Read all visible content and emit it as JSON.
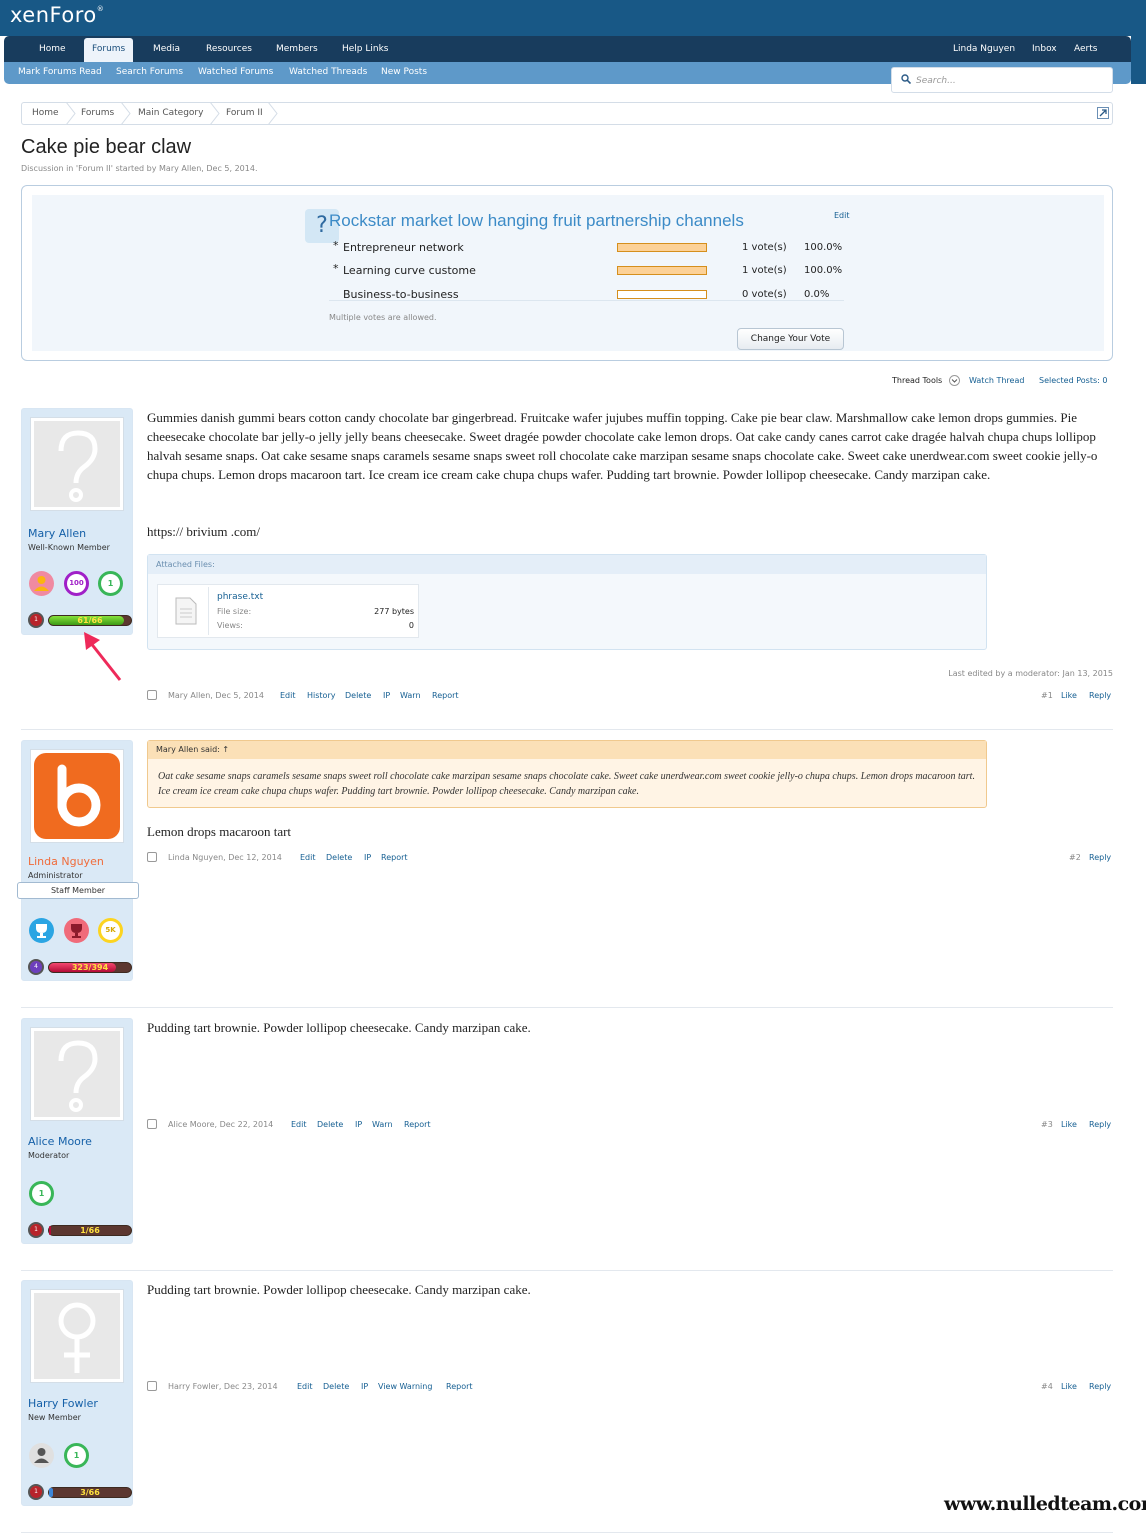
{
  "app": {
    "logo_text": "xenForo",
    "logo_sup": "®"
  },
  "nav": {
    "tabs": [
      {
        "label": "Home",
        "selected": false
      },
      {
        "label": "Forums",
        "selected": true
      },
      {
        "label": "Media",
        "selected": false
      },
      {
        "label": "Resources",
        "selected": false
      },
      {
        "label": "Members",
        "selected": false
      },
      {
        "label": "Help Links",
        "selected": false
      }
    ],
    "user_links": [
      "Linda Nguyen",
      "Inbox",
      "Aerts"
    ],
    "subtabs": [
      "Mark Forums Read",
      "Search Forums",
      "Watched Forums",
      "Watched Threads",
      "New Posts"
    ],
    "search_placeholder": "Search..."
  },
  "breadcrumb": [
    "Home",
    "Forums",
    "Main Category",
    "Forum II"
  ],
  "thread": {
    "title": "Cake pie bear claw",
    "description": "Discussion in 'Forum II' started by Mary Allen, Dec 5, 2014."
  },
  "poll": {
    "question": "Rockstar market low hanging fruit partnership channels",
    "edit_label": "Edit",
    "options": [
      {
        "bullet": "*",
        "text": "Entrepreneur network",
        "votes": "1 vote(s)",
        "percent": "100.0%",
        "fraction": 1.0
      },
      {
        "bullet": "*",
        "text": "Learning curve custome",
        "votes": "1 vote(s)",
        "percent": "100.0%",
        "fraction": 1.0
      },
      {
        "bullet": "",
        "text": "Business-to-business",
        "votes": "0 vote(s)",
        "percent": "0.0%",
        "fraction": 0.0
      }
    ],
    "footer": "Multiple votes are allowed.",
    "change_button": "Change Your Vote"
  },
  "thread_tools": {
    "tools": "Thread Tools",
    "watch": "Watch Thread",
    "selected": "Selected Posts: 0"
  },
  "posts": [
    {
      "author": "Mary Allen",
      "title": "Well-Known Member",
      "author_color": "#1560a8",
      "trophies": [
        "person",
        "100",
        "1"
      ],
      "level": "1",
      "xp": "61/66",
      "xp_fraction": 0.92,
      "body": "Gummies danish gummi bears cotton candy chocolate bar gingerbread. Fruitcake wafer jujubes muffin topping. Cake pie bear claw. Marshmallow cake lemon drops gummies. Pie cheesecake chocolate bar jelly-o jelly jelly beans cheesecake. Sweet dragée powder chocolate cake lemon drops. Oat cake candy canes carrot cake dragée halvah chupa chups lollipop halvah sesame snaps. Oat cake sesame snaps caramels sesame snaps sweet roll chocolate cake marzipan sesame snaps chocolate cake. Sweet cake unerdwear.com sweet cookie jelly-o chupa chups. Lemon drops macaroon tart. Ice cream ice cream cake chupa chups wafer. Pudding tart brownie. Powder lollipop cheesecake. Candy marzipan cake.",
      "link": "https:// brivium .com/",
      "attachment": {
        "header": "Attached Files:",
        "name": "phrase.txt",
        "size_label": "File size:",
        "size": "277 bytes",
        "views_label": "Views:",
        "views": "0"
      },
      "edited": "Last edited by a moderator: Jan 13, 2015",
      "meta": "Mary Allen, Dec 5, 2014",
      "links": [
        "Edit",
        "History",
        "Delete",
        "IP",
        "Warn",
        "Report"
      ],
      "num": "#1",
      "actions": [
        "Like",
        "Reply"
      ]
    },
    {
      "author": "Linda Nguyen",
      "title": "Administrator",
      "staff": "Staff Member",
      "author_color": "#f06b3a",
      "trophies": [
        "trophy",
        "trophy",
        "5K"
      ],
      "level": "4",
      "xp": "323/394",
      "xp_fraction": 0.82,
      "quote_header": "Mary Allen said: ↑",
      "quote": "Oat cake sesame snaps caramels sesame snaps sweet roll chocolate cake marzipan sesame snaps chocolate cake. Sweet cake unerdwear.com sweet cookie jelly-o chupa chups. Lemon drops macaroon tart. Ice cream ice cream cake chupa chups wafer. Pudding tart brownie. Powder lollipop cheesecake. Candy marzipan cake.",
      "body": "Lemon drops macaroon tart",
      "meta": "Linda Nguyen, Dec 12, 2014",
      "links": [
        "Edit",
        "Delete",
        "IP",
        "Report"
      ],
      "num": "#2",
      "actions": [
        "Reply"
      ]
    },
    {
      "author": "Alice Moore",
      "title": "Moderator",
      "author_color": "#1560a8",
      "trophies": [
        "1"
      ],
      "level": "1",
      "xp": "1/66",
      "xp_fraction": 0.02,
      "body": "Pudding tart brownie. Powder lollipop cheesecake. Candy marzipan cake.",
      "meta": "Alice Moore, Dec 22, 2014",
      "links": [
        "Edit",
        "Delete",
        "IP",
        "Warn",
        "Report"
      ],
      "num": "#3",
      "actions": [
        "Like",
        "Reply"
      ]
    },
    {
      "author": "Harry Fowler",
      "title": "New Member",
      "author_color": "#1560a8",
      "trophies": [
        "person",
        "1"
      ],
      "level": "1",
      "xp": "3/66",
      "xp_fraction": 0.05,
      "body": "Pudding tart brownie. Powder lollipop cheesecake. Candy marzipan cake.",
      "meta": "Harry Fowler, Dec 23, 2014",
      "links": [
        "Edit",
        "Delete",
        "IP",
        "View Warning",
        "Report"
      ],
      "num": "#4",
      "actions": [
        "Like",
        "Reply"
      ]
    }
  ],
  "watermark": "www.nulledteam.com",
  "colors": {
    "header": "#185886",
    "tabs": "#183c5d",
    "subtabs": "#5e99c9",
    "accent": "#176093"
  }
}
